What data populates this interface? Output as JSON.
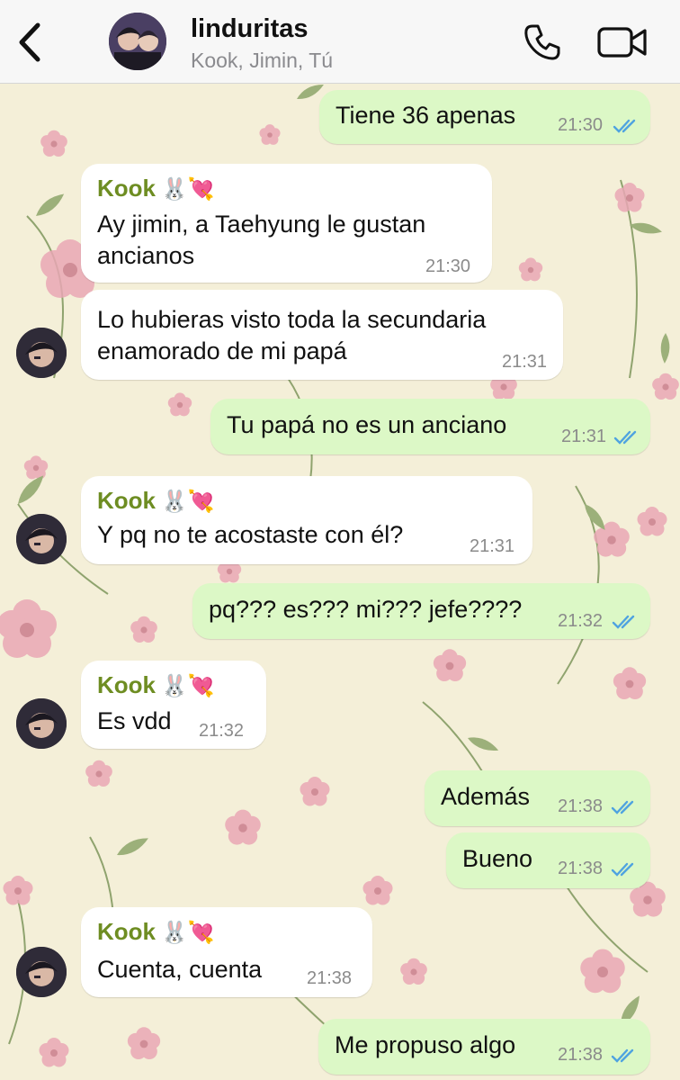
{
  "header": {
    "title": "linduritas",
    "subtitle": "Kook, Jimin, Tú"
  },
  "colors": {
    "outgoing_bubble": "#dcf8c6",
    "incoming_bubble": "#ffffff",
    "sender_name": "#6e8d22",
    "read_ticks": "#4fa3e0",
    "wallpaper": "#f4efd8"
  },
  "messages": [
    {
      "dir": "out",
      "text": "Tiene 36 apenas",
      "time": "21:30",
      "read": true
    },
    {
      "dir": "in",
      "sender": "Kook",
      "sender_emoji": "🐰💘",
      "lines": [
        "Ay jimin, a Taehyung le gustan",
        "ancianos"
      ],
      "time": "21:30"
    },
    {
      "dir": "in",
      "lines": [
        "Lo hubieras visto toda la secundaria",
        "enamorado de mi papá"
      ],
      "time": "21:31",
      "avatar": true
    },
    {
      "dir": "out",
      "text": "Tu papá no es un anciano",
      "time": "21:31",
      "read": true
    },
    {
      "dir": "in",
      "sender": "Kook",
      "sender_emoji": "🐰💘",
      "text": "Y pq no te acostaste con él?",
      "time": "21:31",
      "avatar": true
    },
    {
      "dir": "out",
      "text": "pq??? es??? mi??? jefe????",
      "time": "21:32",
      "read": true
    },
    {
      "dir": "in",
      "sender": "Kook",
      "sender_emoji": "🐰💘",
      "text": "Es vdd",
      "time": "21:32",
      "avatar": true
    },
    {
      "dir": "out",
      "text": "Además",
      "time": "21:38",
      "read": true
    },
    {
      "dir": "out",
      "text": "Bueno",
      "time": "21:38",
      "read": true
    },
    {
      "dir": "in",
      "sender": "Kook",
      "sender_emoji": "🐰💘",
      "text": "Cuenta, cuenta",
      "time": "21:38",
      "avatar": true
    },
    {
      "dir": "out",
      "text": "Me propuso algo",
      "time": "21:38",
      "read": true
    }
  ]
}
